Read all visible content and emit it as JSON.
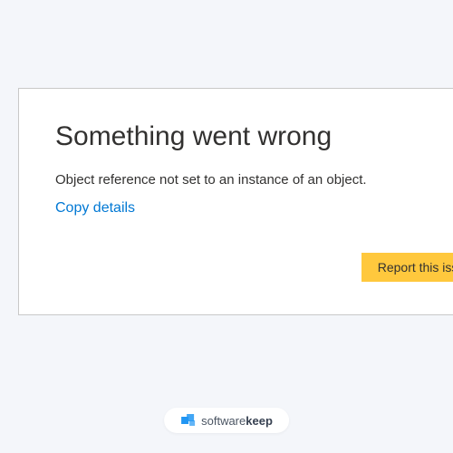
{
  "dialog": {
    "title": "Something went wrong",
    "message": "Object reference not set to an instance of an object.",
    "copy_link": "Copy details",
    "report_button": "Report this issue"
  },
  "branding": {
    "name_part1": "software",
    "name_part2": "keep"
  },
  "colors": {
    "accent_yellow": "#ffc83d",
    "link_blue": "#0078d4",
    "logo_blue": "#2196f3"
  }
}
